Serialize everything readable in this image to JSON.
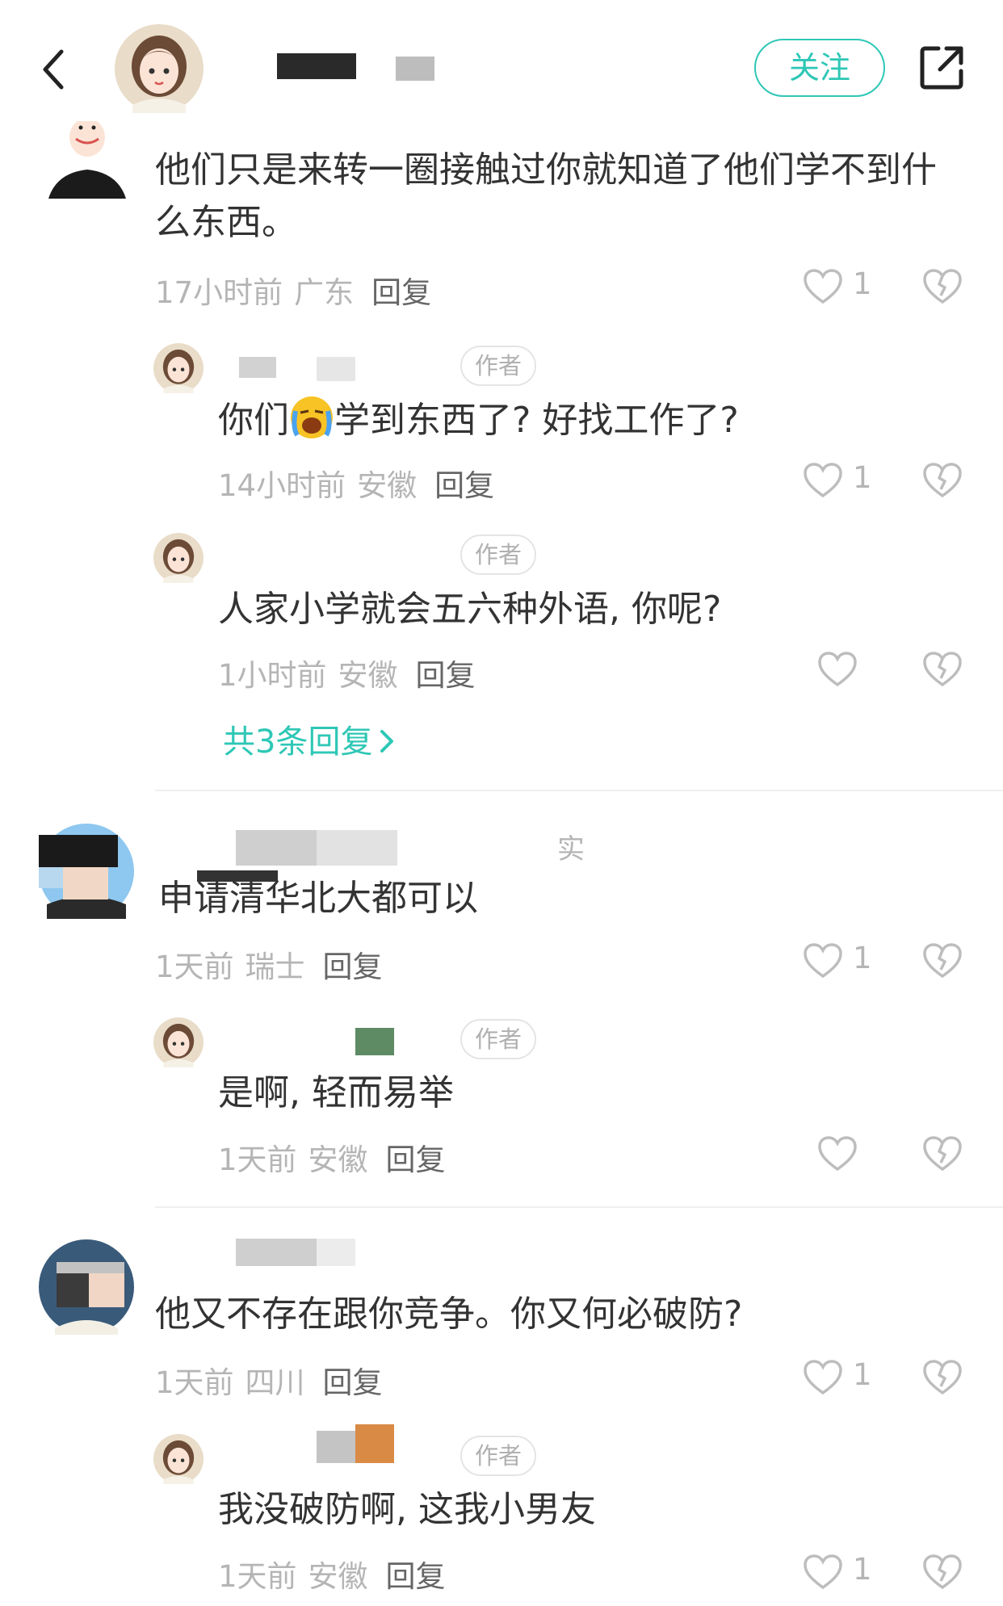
{
  "header": {
    "follow_label": "关注"
  },
  "comments": [
    {
      "text_line1": "他们只是来转一圈接触过你就知道了他们学不到什",
      "text_line2": "么东西。",
      "time": "17小时前",
      "location": "广东",
      "reply": "回复",
      "likes": "1"
    },
    {
      "name_fragment": "实",
      "text": "申请清华北大都可以",
      "time": "1天前",
      "location": "瑞士",
      "reply": "回复",
      "likes": "1"
    },
    {
      "text": "他又不存在跟你竞争。你又何必破防?",
      "time": "1天前",
      "location": "四川",
      "reply": "回复",
      "likes": "1"
    }
  ],
  "replies": [
    {
      "badge": "作者",
      "text_before": "你们",
      "text_after": "学到东西了? 好找工作了?",
      "time": "14小时前",
      "location": "安徽",
      "reply": "回复",
      "likes": "1"
    },
    {
      "badge": "作者",
      "text": "人家小学就会五六种外语, 你呢?",
      "time": "1小时前",
      "location": "安徽",
      "reply": "回复"
    },
    {
      "badge": "作者",
      "text": "是啊, 轻而易举",
      "time": "1天前",
      "location": "安徽",
      "reply": "回复"
    },
    {
      "badge": "作者",
      "text": "我没破防啊, 这我小男友",
      "time": "1天前",
      "location": "安徽",
      "reply": "回复",
      "likes": "1"
    }
  ],
  "more_replies": "共3条回复",
  "colors": {
    "accent": "#2ec7b6",
    "text": "#333333",
    "meta": "#b5b5b5"
  }
}
